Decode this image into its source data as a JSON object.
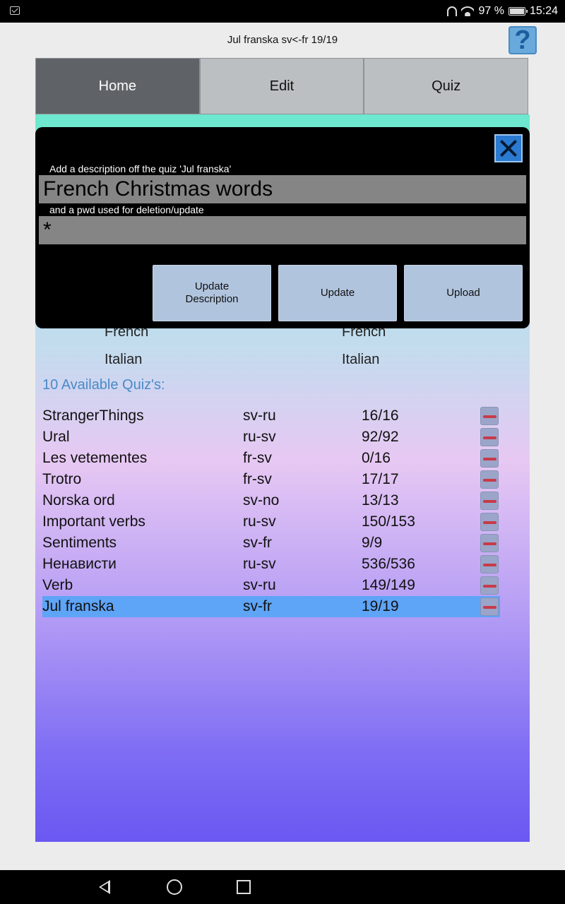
{
  "status_bar": {
    "battery": "97 %",
    "time": "15:24"
  },
  "header": {
    "title": "Jul franska sv<-fr 19/19",
    "help_label": "?"
  },
  "tabs": [
    {
      "label": "Home",
      "active": true
    },
    {
      "label": "Edit",
      "active": false
    },
    {
      "label": "Quiz",
      "active": false
    }
  ],
  "languages": {
    "left": [
      "French",
      "Italian"
    ],
    "right": [
      "French",
      "Italian"
    ]
  },
  "quiz_list": {
    "heading": "10 Available Quiz's:",
    "items": [
      {
        "name": "StrangerThings",
        "lang": "sv-ru",
        "count": "16/16"
      },
      {
        "name": "Ural",
        "lang": "ru-sv",
        "count": "92/92"
      },
      {
        "name": "Les vetementes",
        "lang": "fr-sv",
        "count": "0/16"
      },
      {
        "name": "Trotro",
        "lang": "fr-sv",
        "count": "17/17"
      },
      {
        "name": "Norska ord",
        "lang": "sv-no",
        "count": "13/13"
      },
      {
        "name": "Important verbs",
        "lang": "ru-sv",
        "count": "150/153"
      },
      {
        "name": "Sentiments",
        "lang": "sv-fr",
        "count": "9/9"
      },
      {
        "name": "Ненависти",
        "lang": "ru-sv",
        "count": "536/536"
      },
      {
        "name": "Verb",
        "lang": "sv-ru",
        "count": "149/149"
      },
      {
        "name": "Jul franska",
        "lang": "sv-fr",
        "count": "19/19",
        "selected": true
      }
    ]
  },
  "dialog": {
    "description_label": "Add a description off the quiz 'Jul franska'",
    "description_value": "French Christmas words",
    "pwd_label": "and a pwd used for deletion/update",
    "pwd_value": "*",
    "buttons": {
      "update_description": "Update\nDescription",
      "update": "Update",
      "upload": "Upload"
    }
  },
  "colors": {
    "accent_blue": "#5ea4f7",
    "heading_blue": "#4a8ac7",
    "dialog_button": "#b1c4de",
    "delete_red": "#c83a4a"
  }
}
